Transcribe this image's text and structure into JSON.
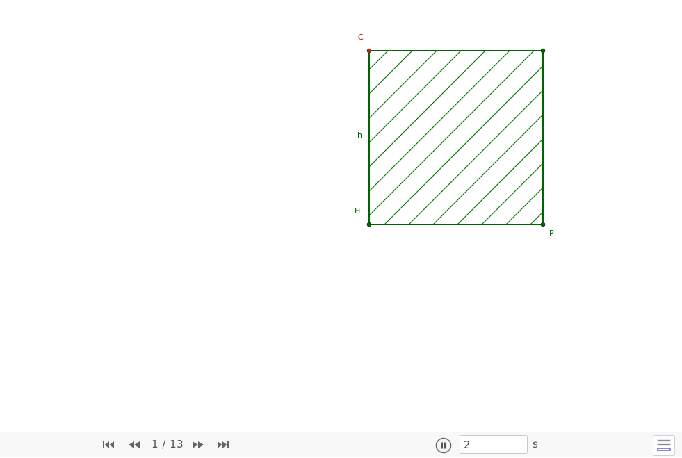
{
  "construction": {
    "labels": {
      "C": "C",
      "h": "h",
      "H": "H",
      "P": "P"
    },
    "colors": {
      "polygon_stroke": "#006400",
      "hatch": "#0a7a0a",
      "point_C": "#cc2200",
      "point_other": "#006400",
      "label_C": "#cc0000",
      "label_other": "#006400"
    }
  },
  "navigation": {
    "step_counter": "1 / 13",
    "first_icon": "skip-first-icon",
    "prev_icon": "rewind-icon",
    "next_icon": "fast-forward-icon",
    "last_icon": "skip-last-icon",
    "play_icon": "pause-icon",
    "speed_value": "2",
    "speed_unit": "s",
    "algebra_icon": "algebra-view-icon"
  }
}
